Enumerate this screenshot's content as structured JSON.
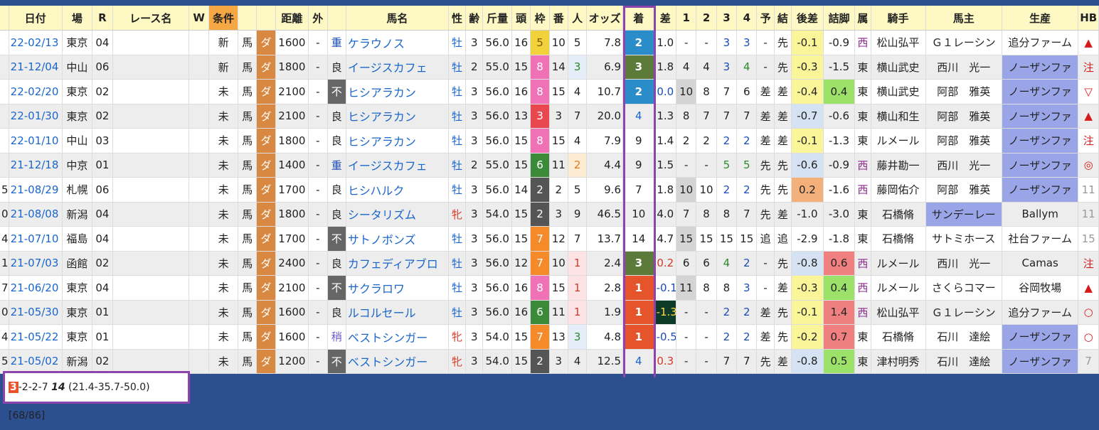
{
  "headers": [
    "日付",
    "場",
    "R",
    "レース名",
    "W",
    "条件",
    "",
    "距離",
    "外",
    "",
    "馬名",
    "性",
    "齢",
    "斤量",
    "頭",
    "枠",
    "番",
    "人",
    "オッズ",
    "着",
    "差",
    "1",
    "2",
    "3",
    "4",
    "予",
    "結",
    "後差",
    "詰脚",
    "属",
    "騎手",
    "馬主",
    "生産",
    "HB"
  ],
  "rows": [
    {
      "lead": "",
      "date": "22-02/13",
      "venue": "東京",
      "r": "04",
      "race": "",
      "w": "",
      "cond": "新",
      "type": "馬",
      "surface": "ダ",
      "dist": "1600",
      "out": "-",
      "track": "重",
      "horse": "ケラウノス",
      "sex": "牡",
      "age": "3",
      "kin": "56.0",
      "heads": "16",
      "waku": "5",
      "ban": "10",
      "pop": "5",
      "odds": "7.8",
      "finish": "2",
      "diff": "1.0",
      "c1": "-",
      "c2": "-",
      "c3": "3",
      "c4": "3",
      "yo": "-",
      "kekka": "先",
      "ato": "-0.1",
      "tsume": "-0.9",
      "zoku": "西",
      "jockey": "松山弘平",
      "owner": "Ｇ１レーシン",
      "breeder": "追分ファーム",
      "hb": "▲"
    },
    {
      "lead": "",
      "date": "21-12/04",
      "venue": "中山",
      "r": "06",
      "race": "",
      "w": "",
      "cond": "新",
      "type": "馬",
      "surface": "ダ",
      "dist": "1800",
      "out": "-",
      "track": "良",
      "horse": "イージスカフェ",
      "sex": "牡",
      "age": "2",
      "kin": "55.0",
      "heads": "15",
      "waku": "8",
      "ban": "14",
      "pop": "3",
      "odds": "6.9",
      "finish": "3",
      "diff": "1.8",
      "c1": "4",
      "c2": "4",
      "c3": "3",
      "c4": "4",
      "yo": "-",
      "kekka": "先",
      "ato": "-0.3",
      "tsume": "-1.5",
      "zoku": "東",
      "jockey": "横山武史",
      "owner": "西川　光一",
      "breeder": "ノーザンファ",
      "hb": "注"
    },
    {
      "lead": "",
      "date": "22-02/20",
      "venue": "東京",
      "r": "02",
      "race": "",
      "w": "",
      "cond": "未",
      "type": "馬",
      "surface": "ダ",
      "dist": "2100",
      "out": "-",
      "track": "不",
      "horse": "ヒシアラカン",
      "sex": "牡",
      "age": "3",
      "kin": "56.0",
      "heads": "16",
      "waku": "8",
      "ban": "15",
      "pop": "4",
      "odds": "10.7",
      "finish": "2",
      "diff": "0.0",
      "c1": "10",
      "c2": "8",
      "c3": "7",
      "c4": "6",
      "yo": "差",
      "kekka": "差",
      "ato": "-0.4",
      "tsume": "0.4",
      "zoku": "東",
      "jockey": "横山武史",
      "owner": "阿部　雅英",
      "breeder": "ノーザンファ",
      "hb": "▽"
    },
    {
      "lead": "",
      "date": "22-01/30",
      "venue": "東京",
      "r": "02",
      "race": "",
      "w": "",
      "cond": "未",
      "type": "馬",
      "surface": "ダ",
      "dist": "2100",
      "out": "-",
      "track": "良",
      "horse": "ヒシアラカン",
      "sex": "牡",
      "age": "3",
      "kin": "56.0",
      "heads": "13",
      "waku": "3",
      "ban": "3",
      "pop": "7",
      "odds": "20.0",
      "finish": "4",
      "diff": "1.3",
      "c1": "8",
      "c2": "7",
      "c3": "7",
      "c4": "7",
      "yo": "差",
      "kekka": "差",
      "ato": "-0.7",
      "tsume": "-0.6",
      "zoku": "東",
      "jockey": "横山和生",
      "owner": "阿部　雅英",
      "breeder": "ノーザンファ",
      "hb": "▲"
    },
    {
      "lead": "",
      "date": "22-01/10",
      "venue": "中山",
      "r": "03",
      "race": "",
      "w": "",
      "cond": "未",
      "type": "馬",
      "surface": "ダ",
      "dist": "1800",
      "out": "-",
      "track": "良",
      "horse": "ヒシアラカン",
      "sex": "牡",
      "age": "3",
      "kin": "56.0",
      "heads": "15",
      "waku": "8",
      "ban": "15",
      "pop": "4",
      "odds": "7.9",
      "finish": "9",
      "diff": "1.4",
      "c1": "2",
      "c2": "2",
      "c3": "2",
      "c4": "2",
      "yo": "差",
      "kekka": "差",
      "ato": "-0.1",
      "tsume": "-1.3",
      "zoku": "東",
      "jockey": "ルメール",
      "owner": "阿部　雅英",
      "breeder": "ノーザンファ",
      "hb": "注"
    },
    {
      "lead": "",
      "date": "21-12/18",
      "venue": "中京",
      "r": "01",
      "race": "",
      "w": "",
      "cond": "未",
      "type": "馬",
      "surface": "ダ",
      "dist": "1400",
      "out": "-",
      "track": "重",
      "horse": "イージスカフェ",
      "sex": "牡",
      "age": "2",
      "kin": "55.0",
      "heads": "15",
      "waku": "6",
      "ban": "11",
      "pop": "2",
      "odds": "4.4",
      "finish": "9",
      "diff": "1.5",
      "c1": "-",
      "c2": "-",
      "c3": "5",
      "c4": "5",
      "yo": "先",
      "kekka": "先",
      "ato": "-0.6",
      "tsume": "-0.9",
      "zoku": "西",
      "jockey": "藤井勘一",
      "owner": "西川　光一",
      "breeder": "ノーザンファ",
      "hb": "◎"
    },
    {
      "lead": "5",
      "date": "21-08/29",
      "venue": "札幌",
      "r": "06",
      "race": "",
      "w": "",
      "cond": "未",
      "type": "馬",
      "surface": "ダ",
      "dist": "1700",
      "out": "-",
      "track": "良",
      "horse": "ヒシハルク",
      "sex": "牡",
      "age": "3",
      "kin": "56.0",
      "heads": "14",
      "waku": "2",
      "ban": "2",
      "pop": "5",
      "odds": "9.6",
      "finish": "7",
      "diff": "1.8",
      "c1": "10",
      "c2": "10",
      "c3": "2",
      "c4": "2",
      "yo": "先",
      "kekka": "先",
      "ato": "0.2",
      "tsume": "-1.6",
      "zoku": "西",
      "jockey": "藤岡佑介",
      "owner": "阿部　雅英",
      "breeder": "ノーザンファ",
      "hb": "11"
    },
    {
      "lead": "0",
      "date": "21-08/08",
      "venue": "新潟",
      "r": "04",
      "race": "",
      "w": "",
      "cond": "未",
      "type": "馬",
      "surface": "ダ",
      "dist": "1800",
      "out": "-",
      "track": "良",
      "horse": "シータリズム",
      "sex": "牝",
      "age": "3",
      "kin": "54.0",
      "heads": "15",
      "waku": "2",
      "ban": "3",
      "pop": "9",
      "odds": "46.5",
      "finish": "10",
      "diff": "4.0",
      "c1": "7",
      "c2": "8",
      "c3": "8",
      "c4": "7",
      "yo": "先",
      "kekka": "差",
      "ato": "-1.0",
      "tsume": "-3.0",
      "zoku": "東",
      "jockey": "石橋脩",
      "owner": "サンデーレー",
      "breeder": "Ballym",
      "hb": "11"
    },
    {
      "lead": "4",
      "date": "21-07/10",
      "venue": "福島",
      "r": "04",
      "race": "",
      "w": "",
      "cond": "未",
      "type": "馬",
      "surface": "ダ",
      "dist": "1700",
      "out": "-",
      "track": "不",
      "horse": "サトノボンズ",
      "sex": "牡",
      "age": "3",
      "kin": "56.0",
      "heads": "15",
      "waku": "7",
      "ban": "12",
      "pop": "7",
      "odds": "13.7",
      "finish": "14",
      "diff": "4.7",
      "c1": "15",
      "c2": "15",
      "c3": "15",
      "c4": "15",
      "yo": "追",
      "kekka": "追",
      "ato": "-2.9",
      "tsume": "-1.8",
      "zoku": "東",
      "jockey": "石橋脩",
      "owner": "サトミホース",
      "breeder": "社台ファーム",
      "hb": "15"
    },
    {
      "lead": "1",
      "date": "21-07/03",
      "venue": "函館",
      "r": "02",
      "race": "",
      "w": "",
      "cond": "未",
      "type": "馬",
      "surface": "ダ",
      "dist": "2400",
      "out": "-",
      "track": "良",
      "horse": "カフェディアブロ",
      "sex": "牡",
      "age": "3",
      "kin": "56.0",
      "heads": "12",
      "waku": "7",
      "ban": "10",
      "pop": "1",
      "odds": "2.4",
      "finish": "3",
      "diff": "0.2",
      "c1": "6",
      "c2": "6",
      "c3": "4",
      "c4": "2",
      "yo": "-",
      "kekka": "先",
      "ato": "-0.8",
      "tsume": "0.6",
      "zoku": "西",
      "jockey": "ルメール",
      "owner": "西川　光一",
      "breeder": "Camas",
      "hb": "注"
    },
    {
      "lead": "7",
      "date": "21-06/20",
      "venue": "東京",
      "r": "04",
      "race": "",
      "w": "",
      "cond": "未",
      "type": "馬",
      "surface": "ダ",
      "dist": "2100",
      "out": "-",
      "track": "不",
      "horse": "サクラロワ",
      "sex": "牡",
      "age": "3",
      "kin": "56.0",
      "heads": "16",
      "waku": "8",
      "ban": "15",
      "pop": "1",
      "odds": "2.8",
      "finish": "1",
      "diff": "-0.1",
      "c1": "11",
      "c2": "8",
      "c3": "8",
      "c4": "3",
      "yo": "-",
      "kekka": "差",
      "ato": "-0.3",
      "tsume": "0.4",
      "zoku": "西",
      "jockey": "ルメール",
      "owner": "さくらコマー",
      "breeder": "谷岡牧場",
      "hb": "▲"
    },
    {
      "lead": "0",
      "date": "21-05/30",
      "venue": "東京",
      "r": "01",
      "race": "",
      "w": "",
      "cond": "未",
      "type": "馬",
      "surface": "ダ",
      "dist": "1600",
      "out": "-",
      "track": "良",
      "horse": "ルコルセール",
      "sex": "牡",
      "age": "3",
      "kin": "56.0",
      "heads": "16",
      "waku": "6",
      "ban": "11",
      "pop": "1",
      "odds": "1.9",
      "finish": "1",
      "diff": "-1.3",
      "c1": "-",
      "c2": "-",
      "c3": "2",
      "c4": "2",
      "yo": "差",
      "kekka": "先",
      "ato": "-0.1",
      "tsume": "1.4",
      "zoku": "西",
      "jockey": "松山弘平",
      "owner": "Ｇ１レーシン",
      "breeder": "追分ファーム",
      "hb": "○"
    },
    {
      "lead": "4",
      "date": "21-05/22",
      "venue": "東京",
      "r": "01",
      "race": "",
      "w": "",
      "cond": "未",
      "type": "馬",
      "surface": "ダ",
      "dist": "1600",
      "out": "-",
      "track": "稍",
      "horse": "ベストシンガー",
      "sex": "牝",
      "age": "3",
      "kin": "54.0",
      "heads": "15",
      "waku": "7",
      "ban": "13",
      "pop": "3",
      "odds": "4.8",
      "finish": "1",
      "diff": "-0.5",
      "c1": "-",
      "c2": "-",
      "c3": "2",
      "c4": "2",
      "yo": "差",
      "kekka": "先",
      "ato": "-0.2",
      "tsume": "0.7",
      "zoku": "東",
      "jockey": "石橋脩",
      "owner": "石川　達絵",
      "breeder": "ノーザンファ",
      "hb": "○"
    },
    {
      "lead": "5",
      "date": "21-05/02",
      "venue": "新潟",
      "r": "02",
      "race": "",
      "w": "",
      "cond": "未",
      "type": "馬",
      "surface": "ダ",
      "dist": "1200",
      "out": "-",
      "track": "不",
      "horse": "ベストシンガー",
      "sex": "牝",
      "age": "3",
      "kin": "54.0",
      "heads": "15",
      "waku": "2",
      "ban": "3",
      "pop": "4",
      "odds": "12.5",
      "finish": "4",
      "diff": "0.3",
      "c1": "-",
      "c2": "-",
      "c3": "7",
      "c4": "7",
      "yo": "先",
      "kekka": "差",
      "ato": "-0.8",
      "tsume": "0.5",
      "zoku": "東",
      "jockey": "津村明秀",
      "owner": "石川　達絵",
      "breeder": "ノーザンファ",
      "hb": "7"
    }
  ],
  "summary": {
    "first": "3",
    "record": "-2-2-7",
    "big": "14",
    "rates": "(21.4-35.7-50.0) [68/86]"
  },
  "colors": {
    "waku": {
      "1": "#ffffff",
      "2": "#555555",
      "3": "#e8474f",
      "4": "#3b7fd8",
      "5": "#f2d23a",
      "6": "#3a8a3a",
      "7": "#f48a2a",
      "8": "#ef72b6"
    },
    "finish": {
      "1": "#e5542b",
      "2": "#2a8cc8",
      "3": "#5c7a3a"
    },
    "breeder_highlight": "#9aa5e8",
    "highlight_border": "#8e44ad"
  }
}
